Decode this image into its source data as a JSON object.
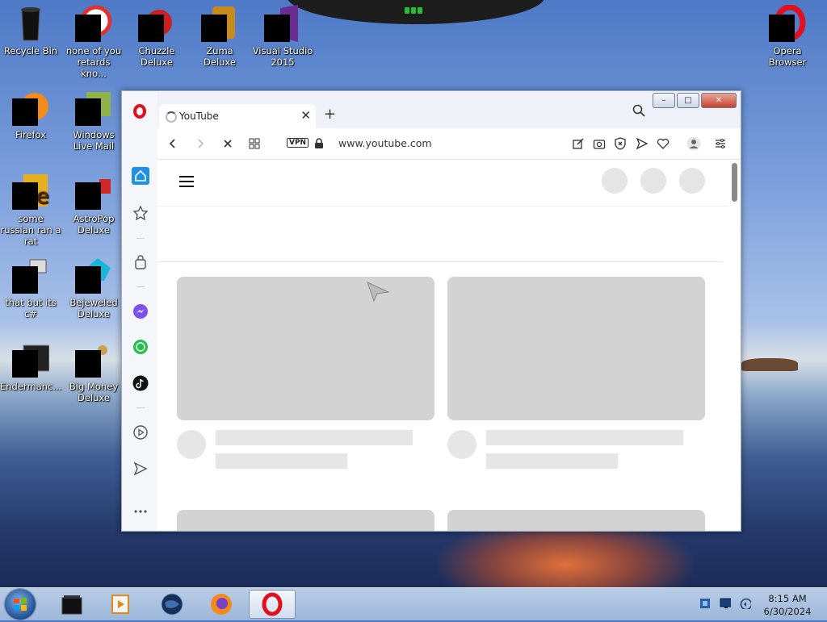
{
  "desktop": {
    "icons": [
      {
        "label": "Recycle Bin"
      },
      {
        "label": "none of you retards kno..."
      },
      {
        "label": "Chuzzle Deluxe"
      },
      {
        "label": "Zuma Deluxe"
      },
      {
        "label": "Visual Studio 2015"
      },
      {
        "label": "Opera Browser"
      },
      {
        "label": "Firefox"
      },
      {
        "label": "Windows Live Mail"
      },
      {
        "label": "some russian ran a rat"
      },
      {
        "label": "AstroPop Deluxe"
      },
      {
        "label": "that but its c#"
      },
      {
        "label": "Bejeweled Deluxe"
      },
      {
        "label": "Endermanc..."
      },
      {
        "label": "Big Money Deluxe"
      }
    ]
  },
  "browser": {
    "tab": {
      "title": "YouTube"
    },
    "vpn_label": "VPN",
    "url": "www.youtube.com",
    "window_controls": {
      "minimize": "–",
      "maximize": "□",
      "close": "✕"
    }
  },
  "taskbar": {
    "clock": {
      "time": "8:15 AM",
      "date": "6/30/2024"
    }
  },
  "colors": {
    "opera_red": "#e0101e",
    "skeleton": "#d3d3d3",
    "taskbar": "#a9c0de"
  }
}
